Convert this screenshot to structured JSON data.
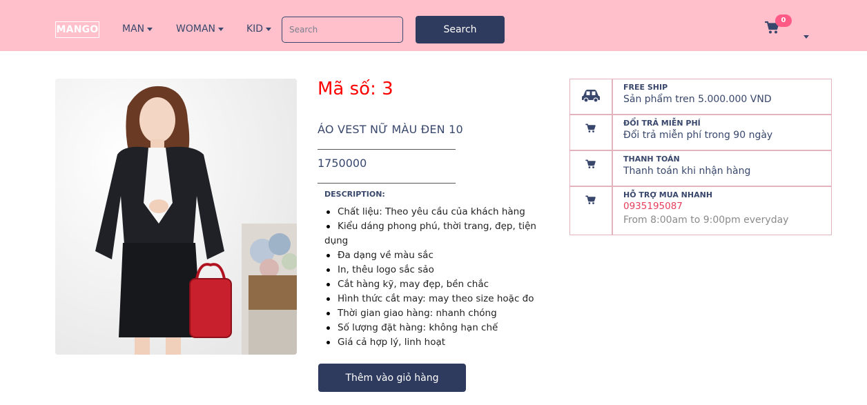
{
  "navbar": {
    "logo": "MANGO",
    "menu": [
      {
        "label": "MAN"
      },
      {
        "label": "WOMAN"
      },
      {
        "label": "KID"
      }
    ],
    "search": {
      "placeholder": "Search",
      "value": ""
    },
    "search_button": "Search",
    "cart_count": "0",
    "cart_icon": "cart-icon",
    "user_menu_icon": "caret-down-icon"
  },
  "product": {
    "image_icon": "product-photo",
    "code": "Mã số: 3",
    "name": "ÁO VEST NỮ MÀU ĐEN 10",
    "price": "1750000",
    "description_title": "DESCRIPTION:",
    "description_items": [
      "Chất liệu: Theo yêu cầu của khách hàng",
      "Kiểu dáng phong phú, thời trang, đẹp, tiện dụng",
      "Đa dạng về màu sắc",
      "In, thêu logo sắc sảo",
      "Cắt hàng kỹ, may đẹp, bền chắc",
      "Hình thức cắt may: may theo size hoặc đo",
      "Thời gian giao hàng: nhanh chóng",
      "Số lượng đặt hàng: không hạn chế",
      "Giá cả hợp lý, linh hoạt"
    ],
    "add_to_cart": "Thêm vào giỏ hàng"
  },
  "services": [
    {
      "icon": "car-icon",
      "title": "FREE SHIP",
      "desc": "Sản phẩm tren 5.000.000 VND"
    },
    {
      "icon": "cart-icon",
      "title": "ĐỔI TRẢ MIỄN PHÍ",
      "desc": "Đổi trả miễn phí trong 90 ngày"
    },
    {
      "icon": "cart-icon",
      "title": "THANH TOÁN",
      "desc": "Thanh toán khi nhận hàng"
    },
    {
      "icon": "cart-icon",
      "title": "HỖ TRỢ MUA NHANH",
      "phone": "0935195087",
      "hours": "From 8:00am to 9:00pm everyday"
    }
  ],
  "colors": {
    "navbar_bg": "#ffc0cb",
    "primary": "#2f3b5e",
    "text": "#38476b",
    "code_red": "#ff0000",
    "badge": "#ff5a86",
    "border_pink": "#e3b4be"
  }
}
